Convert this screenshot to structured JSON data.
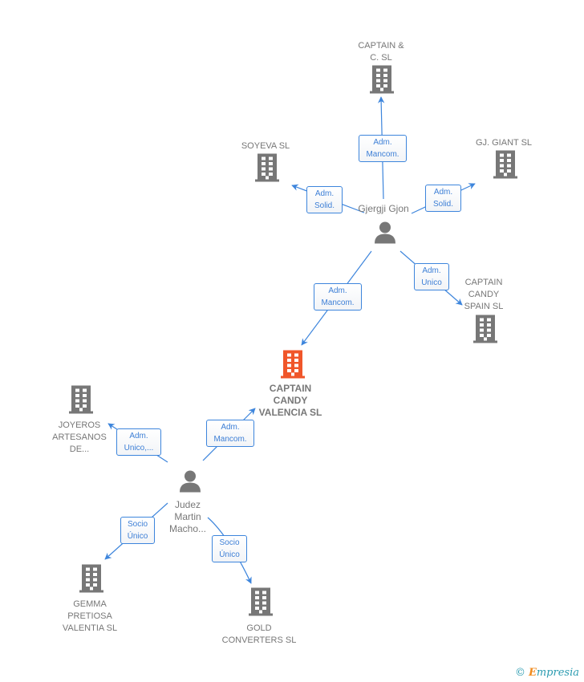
{
  "colors": {
    "company": "#777777",
    "focus_company": "#f0562a",
    "person": "#777777",
    "edge": "#3d85dc",
    "label_text": "#3d7fd6"
  },
  "nodes": [
    {
      "id": "captain_c",
      "type": "company",
      "label": [
        "CAPTAIN &",
        "C.   SL"
      ]
    },
    {
      "id": "soyeva",
      "type": "company",
      "label": [
        "SOYEVA  SL"
      ]
    },
    {
      "id": "gj_giant",
      "type": "company",
      "label": [
        "GJ.  GIANT  SL"
      ]
    },
    {
      "id": "gjon",
      "type": "person",
      "label": [
        "Gjergji Gjon"
      ]
    },
    {
      "id": "spain",
      "type": "company",
      "label": [
        "CAPTAIN",
        "CANDY",
        "SPAIN  SL"
      ]
    },
    {
      "id": "valencia",
      "type": "focus_company",
      "label": [
        "CAPTAIN",
        "CANDY",
        "VALENCIA  SL"
      ]
    },
    {
      "id": "joyeros",
      "type": "company",
      "label": [
        "JOYEROS",
        "ARTESANOS",
        "DE..."
      ]
    },
    {
      "id": "judez",
      "type": "person",
      "label": [
        "Judez",
        "Martin",
        "Macho..."
      ]
    },
    {
      "id": "gemma",
      "type": "company",
      "label": [
        "GEMMA",
        "PRETIOSA",
        "VALENTIA  SL"
      ]
    },
    {
      "id": "gold",
      "type": "company",
      "label": [
        "GOLD",
        "CONVERTERS SL"
      ]
    }
  ],
  "edges": [
    {
      "from": "gjon",
      "to": "captain_c",
      "label": [
        "Adm.",
        "Mancom."
      ]
    },
    {
      "from": "gjon",
      "to": "soyeva",
      "label": [
        "Adm.",
        "Solid."
      ]
    },
    {
      "from": "gjon",
      "to": "gj_giant",
      "label": [
        "Adm.",
        "Solid."
      ]
    },
    {
      "from": "gjon",
      "to": "spain",
      "label": [
        "Adm.",
        "Unico"
      ]
    },
    {
      "from": "gjon",
      "to": "valencia",
      "label": [
        "Adm.",
        "Mancom."
      ]
    },
    {
      "from": "judez",
      "to": "valencia",
      "label": [
        "Adm.",
        "Mancom."
      ]
    },
    {
      "from": "judez",
      "to": "joyeros",
      "label": [
        "Adm.",
        "Unico,..."
      ]
    },
    {
      "from": "judez",
      "to": "gemma",
      "label": [
        "Socio",
        "Único"
      ]
    },
    {
      "from": "judez",
      "to": "gold",
      "label": [
        "Socio",
        "Único"
      ]
    }
  ],
  "watermark": {
    "copyright": "©",
    "brand_initial": "E",
    "brand_rest": "mpresia"
  }
}
